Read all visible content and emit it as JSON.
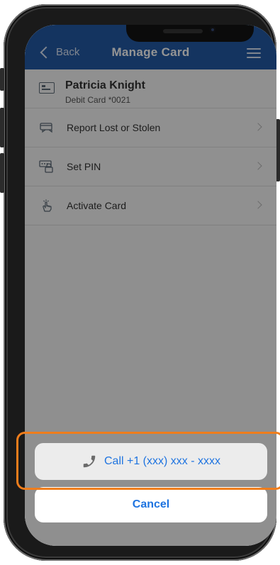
{
  "nav": {
    "back_label": "Back",
    "title": "Manage Card"
  },
  "card": {
    "holder_name": "Patricia Knight",
    "subtitle": "Debit Card *0021"
  },
  "menu_items": [
    {
      "label": "Report Lost or Stolen",
      "icon": "card-exchange-icon"
    },
    {
      "label": "Set PIN",
      "icon": "pin-pad-icon"
    },
    {
      "label": "Activate Card",
      "icon": "tap-hand-icon"
    }
  ],
  "action_sheet": {
    "call_label": "Call +1 (xxx) xxx - xxxx",
    "cancel_label": "Cancel"
  },
  "colors": {
    "nav_bg": "#245aa5",
    "accent": "#1f74e0",
    "highlight": "#ef7d1c"
  }
}
